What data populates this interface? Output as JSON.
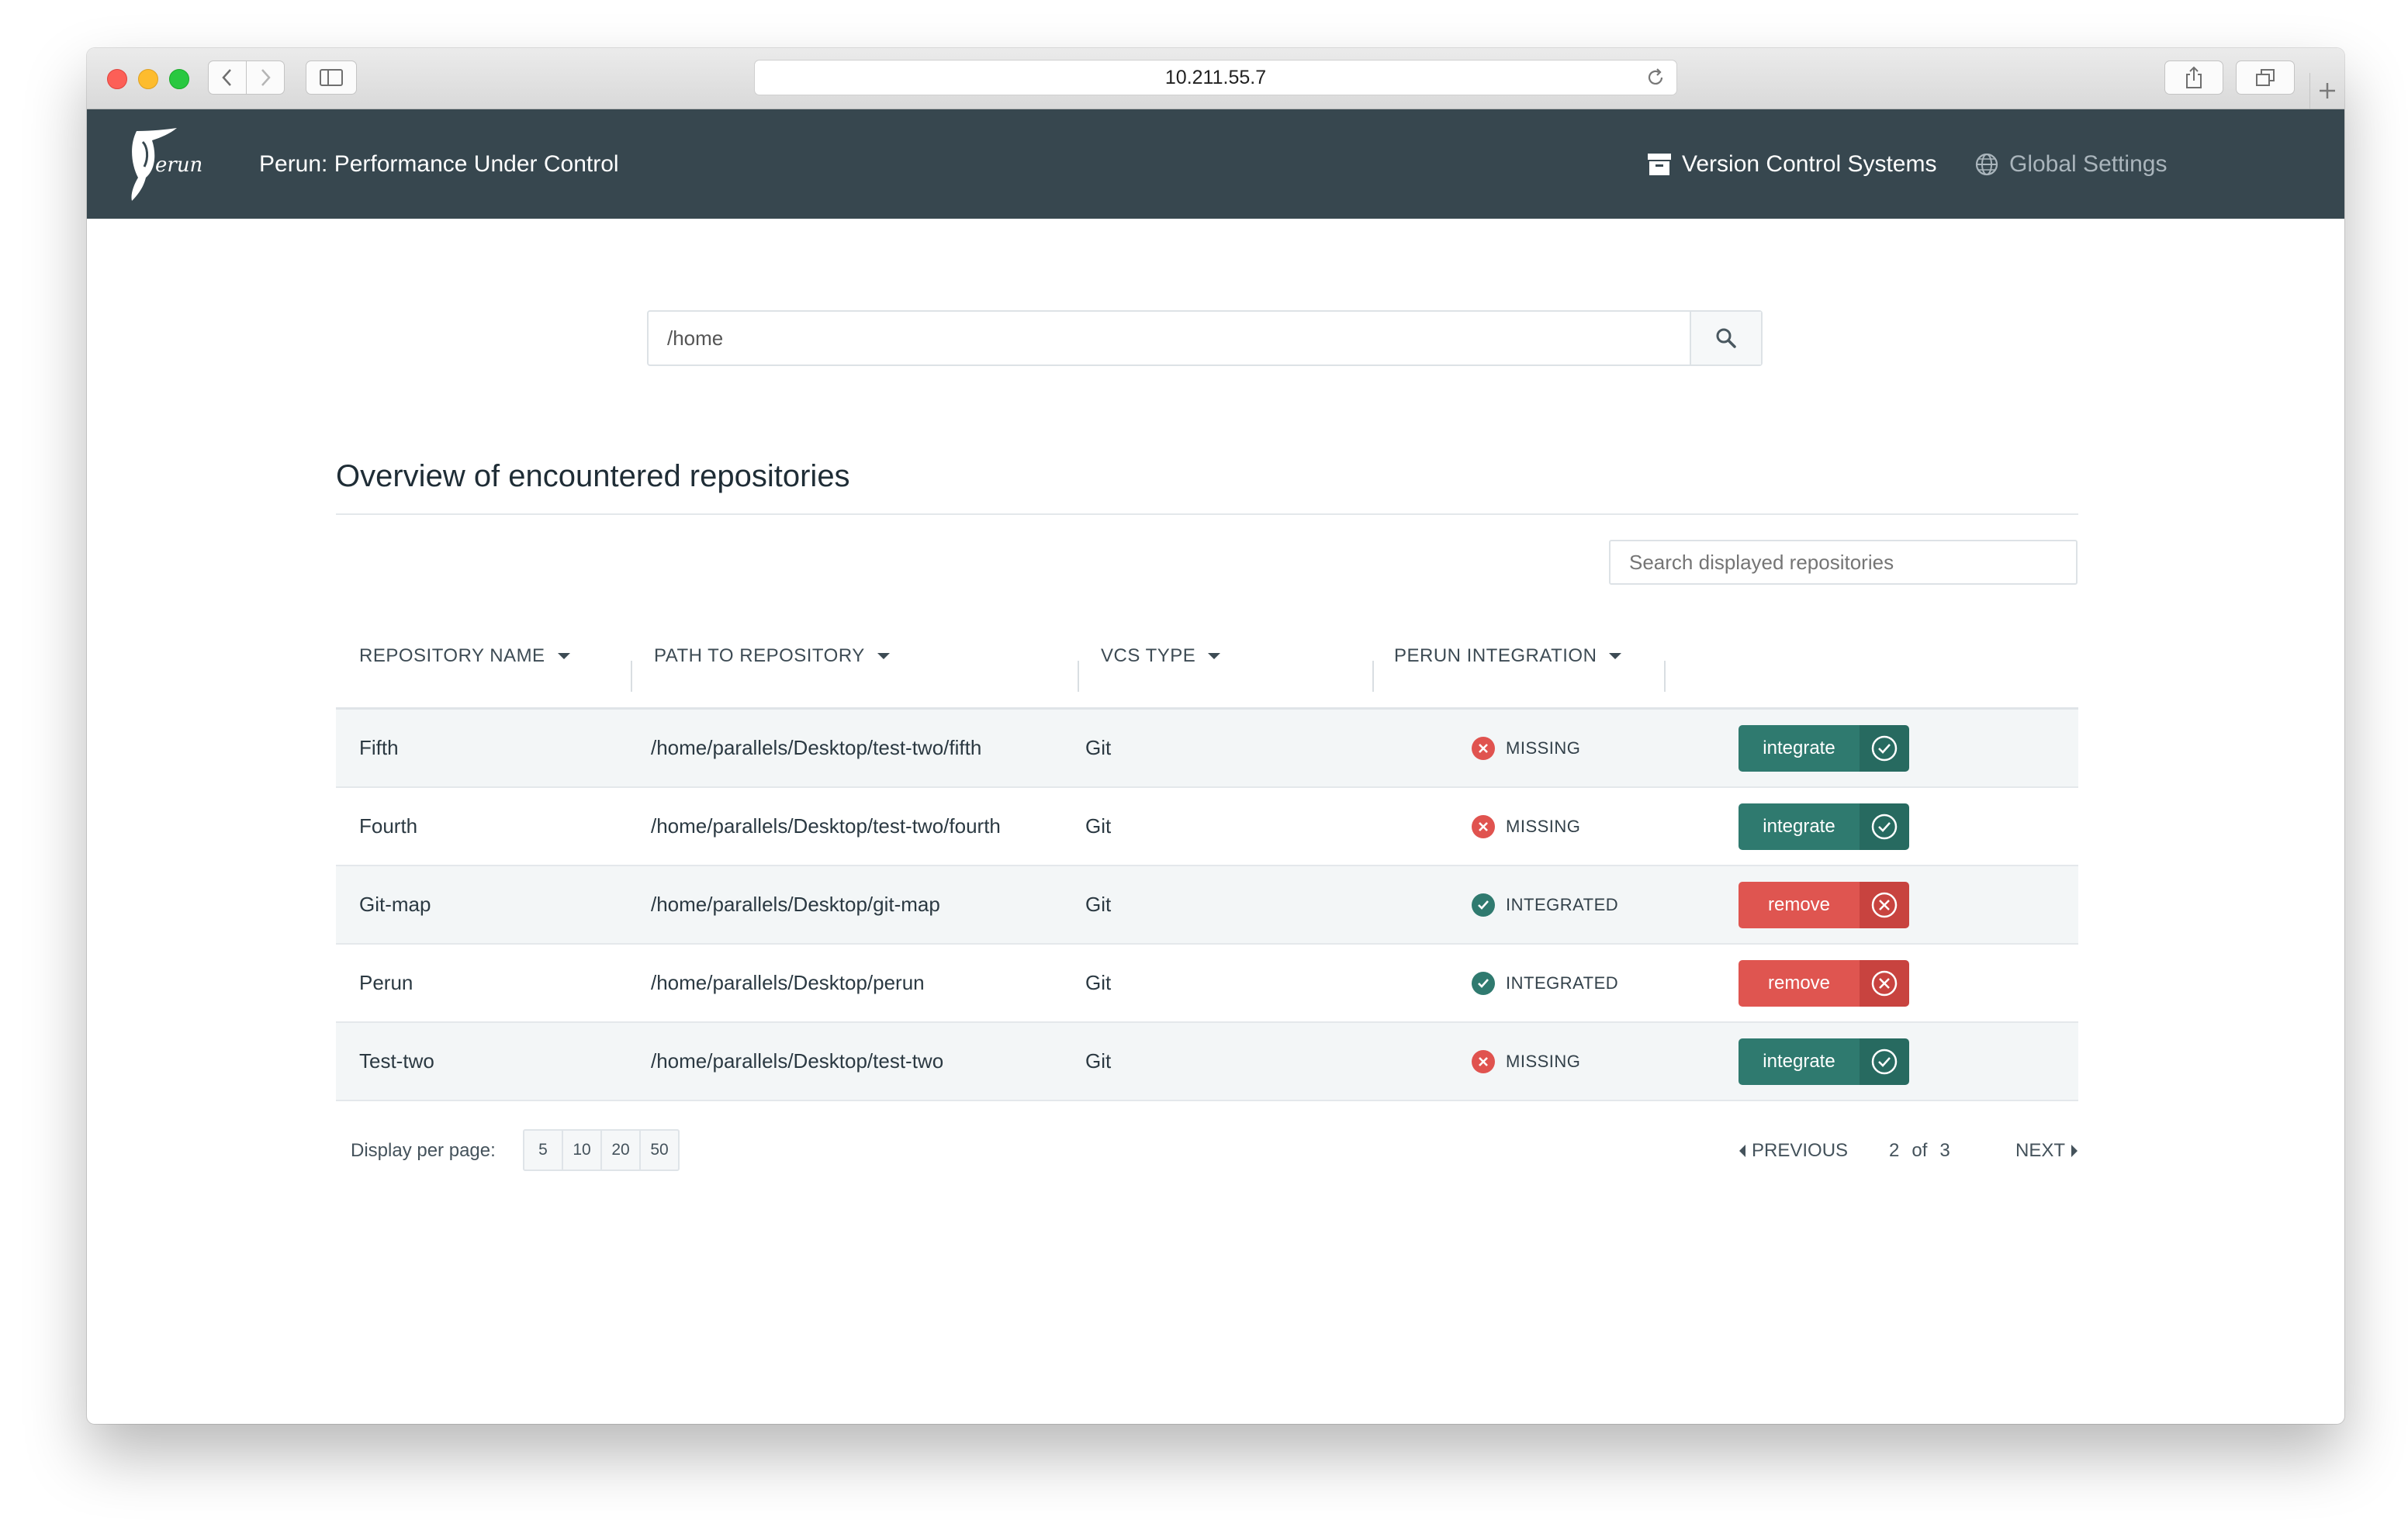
{
  "browser": {
    "url": "10.211.55.7"
  },
  "navbar": {
    "brand": "Perun: Performance Under Control",
    "vcs_label": "Version Control Systems",
    "global_settings_label": "Global Settings",
    "background": "#37474f"
  },
  "search": {
    "value": "/home"
  },
  "overview": {
    "title": "Overview of encountered repositories",
    "filter_placeholder": "Search displayed repositories",
    "columns": [
      "REPOSITORY NAME",
      "PATH TO REPOSITORY",
      "VCS TYPE",
      "PERUN INTEGRATION"
    ],
    "rows": [
      {
        "name": "Fifth",
        "path": "/home/parallels/Desktop/test-two/fifth",
        "vcs": "Git",
        "status": "MISSING",
        "action": "integrate"
      },
      {
        "name": "Fourth",
        "path": "/home/parallels/Desktop/test-two/fourth",
        "vcs": "Git",
        "status": "MISSING",
        "action": "integrate"
      },
      {
        "name": "Git-map",
        "path": "/home/parallels/Desktop/git-map",
        "vcs": "Git",
        "status": "INTEGRATED",
        "action": "remove"
      },
      {
        "name": "Perun",
        "path": "/home/parallels/Desktop/perun",
        "vcs": "Git",
        "status": "INTEGRATED",
        "action": "remove"
      },
      {
        "name": "Test-two",
        "path": "/home/parallels/Desktop/test-two",
        "vcs": "Git",
        "status": "MISSING",
        "action": "integrate"
      }
    ]
  },
  "pagination": {
    "per_page_label": "Display per page:",
    "per_page_options": [
      "5",
      "10",
      "20",
      "50"
    ],
    "previous": "PREVIOUS",
    "current": "2",
    "of": "of",
    "total": "3",
    "next": "NEXT"
  },
  "colors": {
    "integrate": "#2f7a6f",
    "remove": "#df5550",
    "missing": "#e0534f",
    "integrated": "#2f7a6f"
  }
}
